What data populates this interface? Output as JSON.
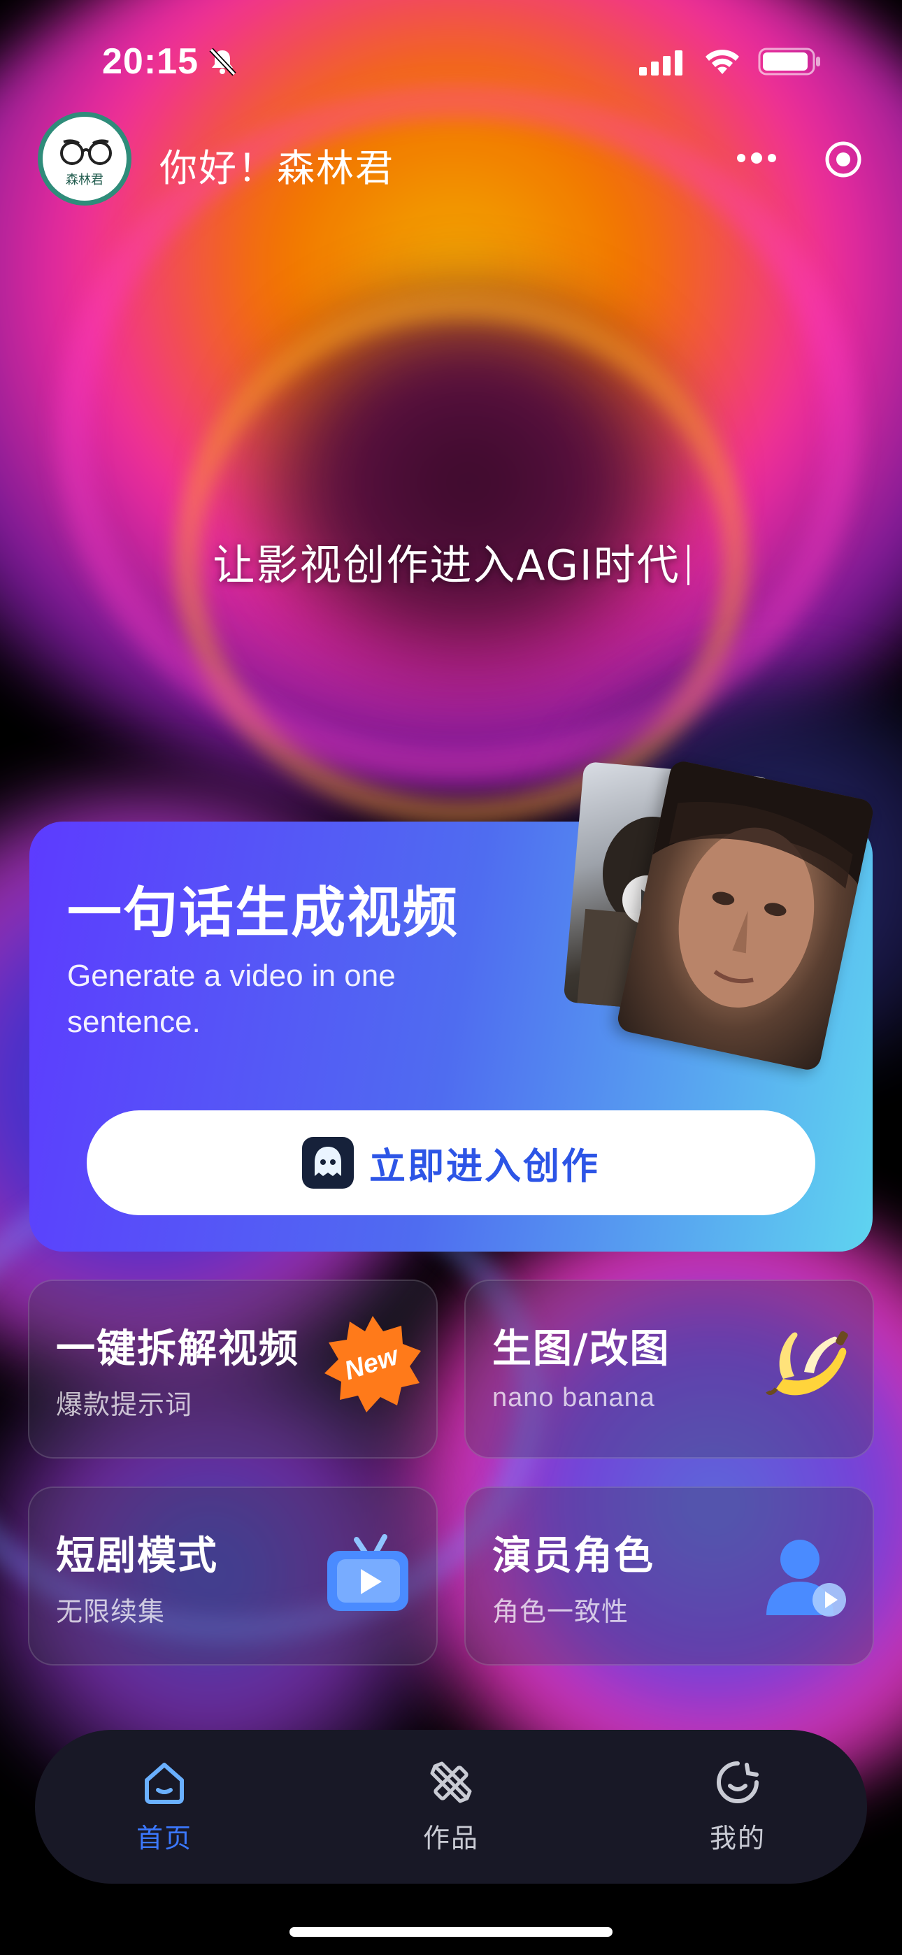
{
  "status_bar": {
    "time": "20:15",
    "icons": [
      "bell-slash-icon",
      "cellular-signal-icon",
      "wifi-icon",
      "battery-icon"
    ]
  },
  "header": {
    "avatar_text": "森林君",
    "greeting": "你好！森林君",
    "capsule_icons": [
      "more-dots-icon",
      "target-icon"
    ]
  },
  "slogan": "让影视创作进入AGI时代",
  "hero": {
    "title": "一句话生成视频",
    "subtitle": "Generate a video in one sentence.",
    "button_label": "立即进入创作",
    "button_icon": "ghost-app-icon"
  },
  "features": [
    {
      "title": "一键拆解视频",
      "subtitle": "爆款提示词",
      "badge": "New",
      "icon": "new-badge-icon"
    },
    {
      "title": "生图/改图",
      "subtitle": "nano banana",
      "icon": "banana-icon"
    },
    {
      "title": "短剧模式",
      "subtitle": "无限续集",
      "icon": "tv-play-icon"
    },
    {
      "title": "演员角色",
      "subtitle": "角色一致性",
      "icon": "actor-icon"
    }
  ],
  "tabbar": {
    "items": [
      {
        "label": "首页",
        "icon": "home-icon",
        "active": true
      },
      {
        "label": "作品",
        "icon": "pencil-ruler-icon",
        "active": false
      },
      {
        "label": "我的",
        "icon": "profile-icon",
        "active": false
      }
    ]
  },
  "colors": {
    "accent": "#3B78FF",
    "hero_gradient_start": "#5D3BFF",
    "hero_gradient_end": "#5FD4F0",
    "tabbar_bg": "#181826"
  }
}
